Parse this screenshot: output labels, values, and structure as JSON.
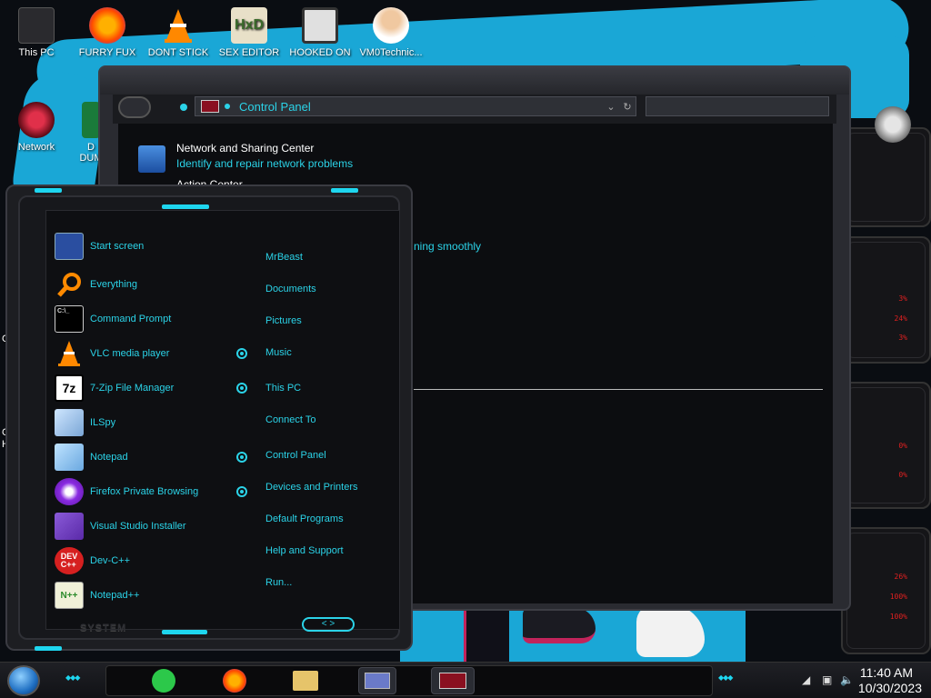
{
  "desktop": {
    "icons": [
      {
        "label": "This PC"
      },
      {
        "label": "FURRY FUX"
      },
      {
        "label": "DONT STICK"
      },
      {
        "label": "SEX EDITOR"
      },
      {
        "label": "HOOKED ON"
      },
      {
        "label": "VM0Technic..."
      },
      {
        "label": "Network"
      },
      {
        "label": "D"
      },
      {
        "label": "DUM"
      },
      {
        "label": "C"
      },
      {
        "label": "C"
      },
      {
        "label": "H"
      }
    ]
  },
  "control_panel": {
    "address": "Control Panel",
    "items": [
      {
        "title": "Network and Sharing Center",
        "link": "Identify and repair network problems"
      },
      {
        "title": "Action Center"
      }
    ],
    "fragment": "ning smoothly"
  },
  "start_menu": {
    "programs": [
      {
        "label": "Start screen",
        "icon": "start-screen-icon"
      },
      {
        "label": "Everything",
        "icon": "magnifier-icon"
      },
      {
        "label": "Command Prompt",
        "icon": "cmd-icon"
      },
      {
        "label": "VLC media player",
        "icon": "vlc-cone-icon"
      },
      {
        "label": "7-Zip File Manager",
        "icon": "7zip-icon"
      },
      {
        "label": "ILSpy",
        "icon": "ilspy-icon"
      },
      {
        "label": "Notepad",
        "icon": "notepad-icon"
      },
      {
        "label": "Firefox Private Browsing",
        "icon": "firefox-private-icon"
      },
      {
        "label": "Visual Studio Installer",
        "icon": "visual-studio-icon"
      },
      {
        "label": "Dev-C++",
        "icon": "devcpp-icon"
      },
      {
        "label": "Notepad++",
        "icon": "notepadpp-icon"
      }
    ],
    "places": [
      {
        "label": "MrBeast"
      },
      {
        "label": "Documents"
      },
      {
        "label": "Pictures"
      },
      {
        "label": "Music"
      },
      {
        "label": "This PC"
      },
      {
        "label": "Connect To"
      },
      {
        "label": "Control Panel"
      },
      {
        "label": "Devices and Printers"
      },
      {
        "label": "Default Programs"
      },
      {
        "label": "Help and Support"
      },
      {
        "label": "Run..."
      }
    ],
    "footer_label": "SYSTEM",
    "footer_arrows": "< >"
  },
  "gadgets": {
    "readouts": [
      "3%",
      "24%",
      "3%",
      "0%",
      "0%",
      "26%",
      "100%",
      "100%"
    ]
  },
  "taskbar": {
    "time": "11:40 AM",
    "date": "10/30/2023"
  },
  "colors": {
    "accent": "#2bd3e8",
    "wallpaper_blue": "#1aa7d6",
    "gadget_red": "#e02020"
  }
}
